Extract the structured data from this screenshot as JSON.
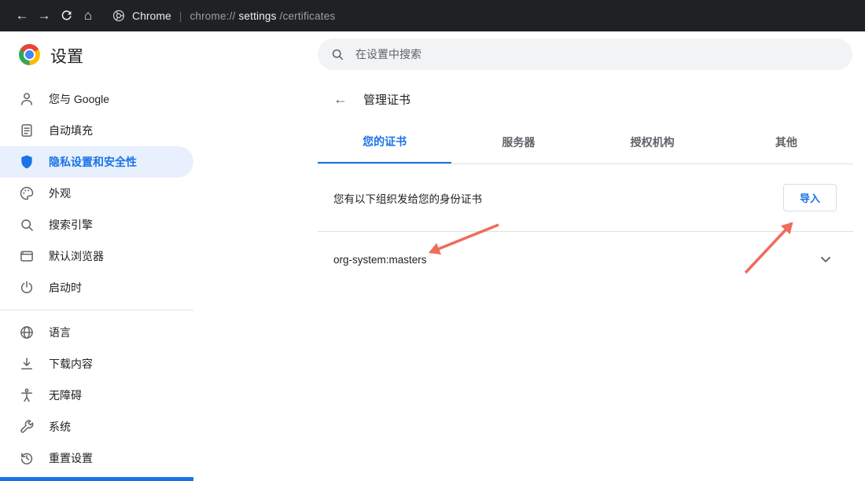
{
  "topbar": {
    "icons": {
      "back": "←",
      "forward": "→",
      "home": "⌂"
    },
    "brand": "Chrome",
    "separator": "|",
    "url_prefix": "chrome://",
    "url_emph": "settings",
    "url_suffix": "/certificates"
  },
  "header": {
    "title": "设置",
    "search_placeholder": "在设置中搜索"
  },
  "sidebar": {
    "items": [
      {
        "label": "您与 Google",
        "icon": "person-icon"
      },
      {
        "label": "自动填充",
        "icon": "autofill-icon"
      },
      {
        "label": "隐私设置和安全性",
        "icon": "shield-icon",
        "active": true
      },
      {
        "label": "外观",
        "icon": "palette-icon"
      },
      {
        "label": "搜索引擎",
        "icon": "search-icon"
      },
      {
        "label": "默认浏览器",
        "icon": "browser-icon"
      },
      {
        "label": "启动时",
        "icon": "power-icon"
      },
      {
        "label": "语言",
        "icon": "globe-icon"
      },
      {
        "label": "下载内容",
        "icon": "download-icon"
      },
      {
        "label": "无障碍",
        "icon": "accessibility-icon"
      },
      {
        "label": "系统",
        "icon": "wrench-icon"
      },
      {
        "label": "重置设置",
        "icon": "history-icon"
      }
    ]
  },
  "content": {
    "back_icon": "←",
    "page_title": "管理证书",
    "tabs": [
      {
        "label": "您的证书",
        "active": true
      },
      {
        "label": "服务器",
        "active": false
      },
      {
        "label": "授权机构",
        "active": false
      },
      {
        "label": "其他",
        "active": false
      }
    ],
    "description": "您有以下组织发给您的身份证书",
    "import_button": "导入",
    "certs": [
      {
        "name": "org-system:masters"
      }
    ]
  },
  "colors": {
    "accent": "#1a73e8",
    "active_item_bg": "#e8f0fe",
    "topbar_bg": "#202124",
    "annotation_arrow": "#ef6c5d"
  }
}
